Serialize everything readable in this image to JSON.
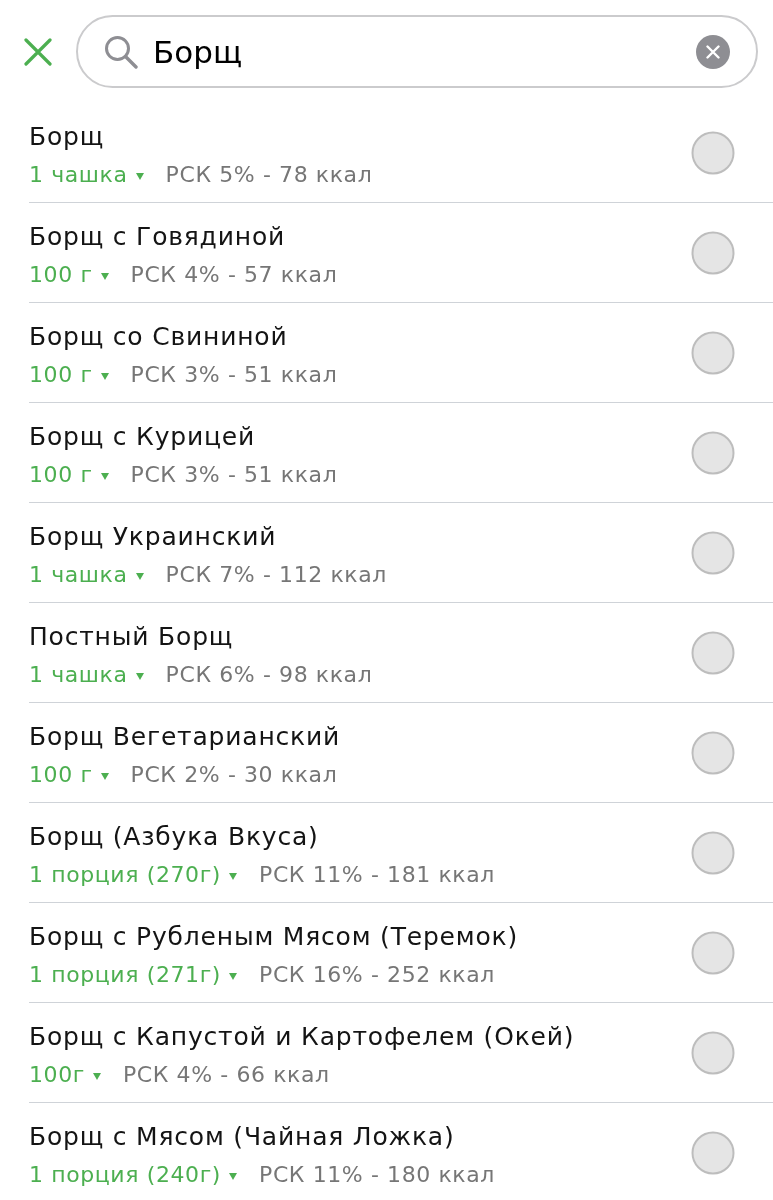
{
  "search": {
    "value": "Борщ"
  },
  "results": [
    {
      "name": "Борщ",
      "serving": "1 чашка",
      "summary": "РСК 5% - 78 ккал",
      "selected": false
    },
    {
      "name": "Борщ с Говядиной",
      "serving": "100 г",
      "summary": "РСК 4% - 57 ккал",
      "selected": false
    },
    {
      "name": "Борщ со Свининой",
      "serving": "100 г",
      "summary": "РСК 3% - 51 ккал",
      "selected": false
    },
    {
      "name": "Борщ с Курицей",
      "serving": "100 г",
      "summary": "РСК 3% - 51 ккал",
      "selected": false
    },
    {
      "name": "Борщ Украинский",
      "serving": "1 чашка",
      "summary": "РСК 7% - 112 ккал",
      "selected": false
    },
    {
      "name": "Постный Борщ",
      "serving": "1 чашка",
      "summary": "РСК 6% - 98 ккал",
      "selected": false
    },
    {
      "name": "Борщ Вегетарианский",
      "serving": "100 г",
      "summary": "РСК 2% - 30 ккал",
      "selected": false
    },
    {
      "name": "Борщ (Азбука Вкуса)",
      "serving": "1 порция (270г)",
      "summary": "РСК 11% - 181 ккал",
      "selected": false
    },
    {
      "name": "Борщ с Рубленым Мясом (Теремок)",
      "serving": "1 порция (271г)",
      "summary": "РСК 16% - 252 ккал",
      "selected": false
    },
    {
      "name": "Борщ с Капустой и Картофелем (Окей)",
      "serving": "100г",
      "summary": "РСК 4% - 66 ккал",
      "selected": false
    },
    {
      "name": "Борщ с Мясом (Чайная Ложка)",
      "serving": "1 порция (240г)",
      "summary": "РСК 11% - 180 ккал",
      "selected": false
    }
  ]
}
